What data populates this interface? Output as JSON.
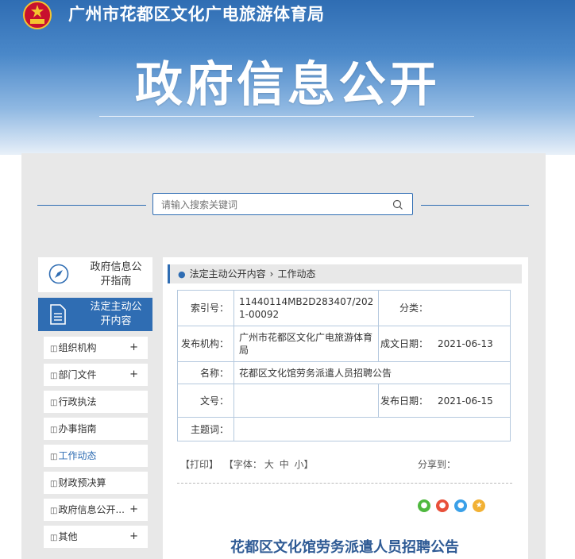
{
  "header": {
    "bureau_name": "广州市花都区文化广电旅游体育局",
    "top_links": "",
    "section_title": "政府信息公开"
  },
  "search": {
    "placeholder": "请输入搜索关键词"
  },
  "sidebar": {
    "guide_label": "政府信息公开指南",
    "active_label": "法定主动公开内容",
    "items": [
      {
        "label": "组织机构",
        "has_plus": true
      },
      {
        "label": "部门文件",
        "has_plus": true
      },
      {
        "label": "行政执法",
        "has_plus": false
      },
      {
        "label": "办事指南",
        "has_plus": false
      },
      {
        "label": "工作动态",
        "has_plus": false
      },
      {
        "label": "财政预决算",
        "has_plus": false
      },
      {
        "label": "政府信息公开...",
        "has_plus": true
      },
      {
        "label": "其他",
        "has_plus": true
      }
    ]
  },
  "breadcrumb": {
    "level1": "法定主动公开内容",
    "level2": "工作动态"
  },
  "meta": {
    "index_label": "索引号：",
    "index_value": "11440114MB2D283407/2021-00092",
    "category_label": "分类：",
    "category_value": "",
    "publisher_label": "发布机构：",
    "publisher_value": "广州市花都区文化广电旅游体育局",
    "created_label": "成文日期：",
    "created_value": "2021-06-13",
    "name_label": "名称：",
    "name_value": "花都区文化馆劳务派遣人员招聘公告",
    "docno_label": "文号：",
    "docno_value": "",
    "published_label": "发布日期：",
    "published_value": "2021-06-15",
    "keywords_label": "主题词："
  },
  "tools": {
    "print": "【打印】",
    "font_label": "【字体：",
    "font_large": "大",
    "font_medium": "中",
    "font_small": "小】",
    "share_label": "分享到："
  },
  "share_icons": [
    "wechat-icon",
    "weibo-icon",
    "qq-icon",
    "qzone-icon"
  ],
  "article": {
    "title": "花都区文化馆劳务派遣人员招聘公告"
  },
  "colors": {
    "primary": "#2f6db3",
    "title_blue": "#2f5b95",
    "panel_bg": "#e8e8e8"
  }
}
